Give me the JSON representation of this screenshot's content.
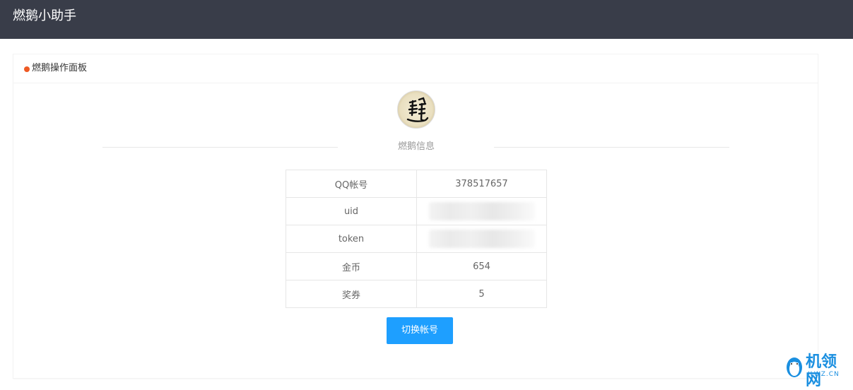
{
  "app": {
    "title": "燃鹅小助手"
  },
  "panel": {
    "title": "燃鹅操作面板"
  },
  "profile": {
    "section_title": "燃鹅信息",
    "rows": [
      {
        "label": "QQ帐号",
        "value": "378517657"
      },
      {
        "label": "uid",
        "value": ""
      },
      {
        "label": "token",
        "value": ""
      },
      {
        "label": "金币",
        "value": "654"
      },
      {
        "label": "奖券",
        "value": "5"
      }
    ]
  },
  "actions": {
    "switch_account_label": "切换帐号"
  },
  "watermark": {
    "brand": "机领网",
    "domain": "JLWZ.CN"
  },
  "colors": {
    "topbar": "#393d49",
    "accent_dot": "#ee5a24",
    "button": "#1e9fff"
  }
}
